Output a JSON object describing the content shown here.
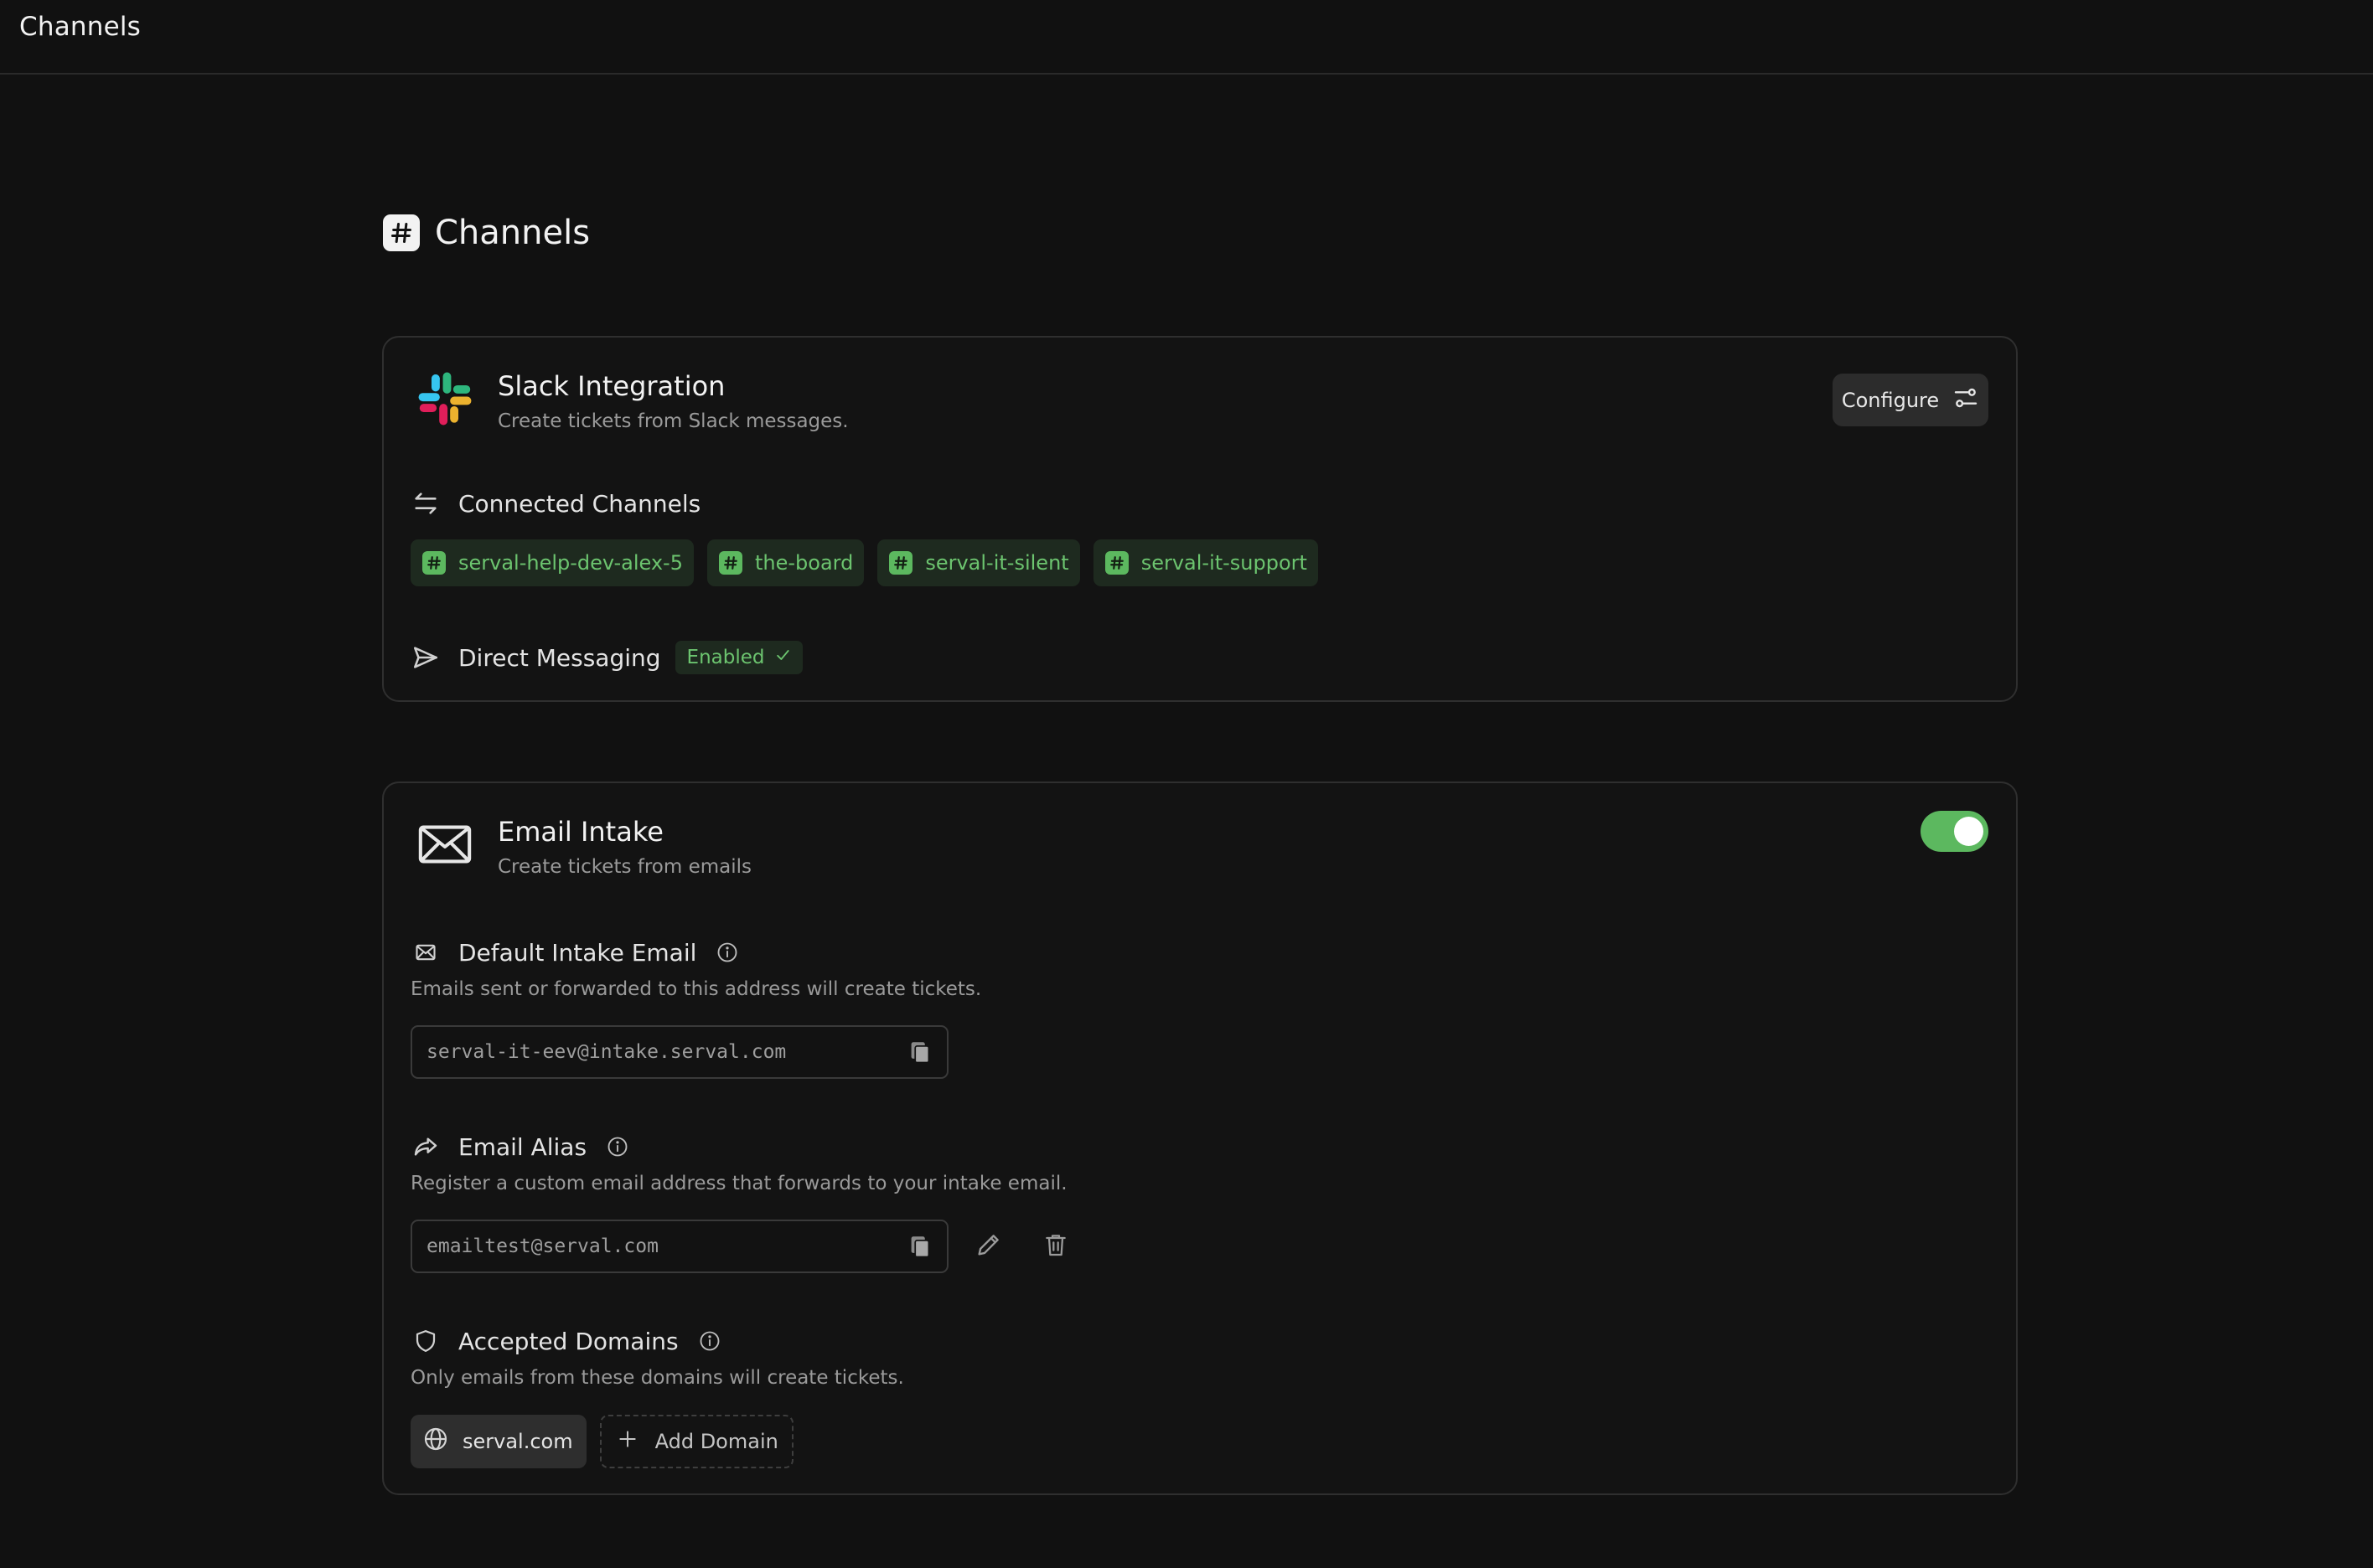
{
  "topbar": {
    "title": "Channels"
  },
  "page": {
    "title": "Channels"
  },
  "slack": {
    "title": "Slack Integration",
    "subtitle": "Create tickets from Slack messages.",
    "configure_label": "Configure",
    "connected_label": "Connected Channels",
    "channels": [
      "serval-help-dev-alex-5",
      "the-board",
      "serval-it-silent",
      "serval-it-support"
    ],
    "dm_label": "Direct Messaging",
    "dm_status": "Enabled"
  },
  "email": {
    "title": "Email Intake",
    "subtitle": "Create tickets from emails",
    "enabled": true,
    "default_label": "Default Intake Email",
    "default_desc": "Emails sent or forwarded to this address will create tickets.",
    "default_value": "serval-it-eev@intake.serval.com",
    "alias_label": "Email Alias",
    "alias_desc": "Register a custom email address that forwards to your intake email.",
    "alias_value": "emailtest@serval.com",
    "domains_label": "Accepted Domains",
    "domains_desc": "Only emails from these domains will create tickets.",
    "domains": [
      "serval.com"
    ],
    "add_domain_label": "Add Domain"
  },
  "colors": {
    "background": "#111111",
    "accent_green": "#5cb85f",
    "chip_green_bg": "#1e2a1f",
    "border": "#2f2f2f"
  }
}
